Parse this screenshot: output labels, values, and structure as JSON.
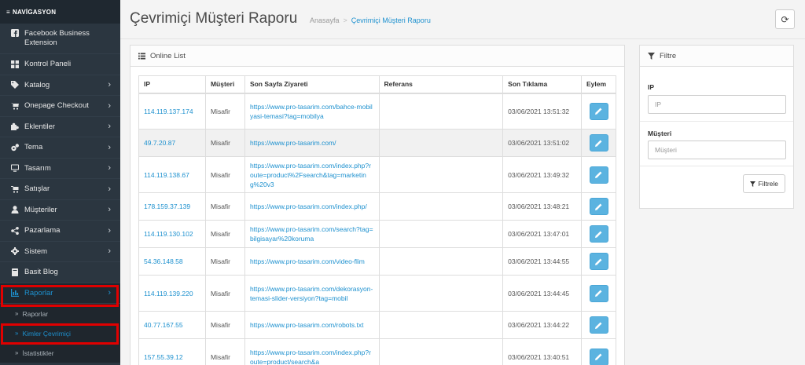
{
  "sidebar": {
    "header": "NAVİGASYON",
    "items": [
      {
        "label": "Facebook Business Extension",
        "icon": "facebook-icon",
        "chevron": false
      },
      {
        "label": "Kontrol Paneli",
        "icon": "dashboard-icon",
        "chevron": false
      },
      {
        "label": "Katalog",
        "icon": "tag-icon",
        "chevron": true
      },
      {
        "label": "Onepage Checkout",
        "icon": "cart-icon",
        "chevron": true
      },
      {
        "label": "Eklentiler",
        "icon": "puzzle-icon",
        "chevron": true
      },
      {
        "label": "Tema",
        "icon": "cogs-icon",
        "chevron": true
      },
      {
        "label": "Tasarım",
        "icon": "desktop-icon",
        "chevron": true
      },
      {
        "label": "Satışlar",
        "icon": "shopping-cart-icon",
        "chevron": true
      },
      {
        "label": "Müşteriler",
        "icon": "user-icon",
        "chevron": true
      },
      {
        "label": "Pazarlama",
        "icon": "share-icon",
        "chevron": true
      },
      {
        "label": "Sistem",
        "icon": "gear-icon",
        "chevron": true
      },
      {
        "label": "Basit Blog",
        "icon": "book-icon",
        "chevron": false
      },
      {
        "label": "Raporlar",
        "icon": "bar-chart-icon",
        "chevron": true
      }
    ],
    "subitems": [
      "Raporlar",
      "Kimler Çevrimiçi",
      "İstatistikler"
    ]
  },
  "header": {
    "title": "Çevrimiçi Müşteri Raporu",
    "breadcrumb_home": "Anasayfa",
    "breadcrumb_sep": ">",
    "breadcrumb_current": "Çevrimiçi Müşteri Raporu"
  },
  "list": {
    "heading": "Online List",
    "columns": [
      "IP",
      "Müşteri",
      "Son Sayfa Ziyareti",
      "Referans",
      "Son Tıklama",
      "Eylem"
    ],
    "rows": [
      {
        "ip": "114.119.137.174",
        "customer": "Misafir",
        "url": "https://www.pro-tasarim.com/bahce-mobilyasi-temasi?tag=mobilya",
        "ref": "",
        "date": "03/06/2021 13:51:32"
      },
      {
        "ip": "49.7.20.87",
        "customer": "Misafir",
        "url": "https://www.pro-tasarim.com/",
        "ref": "",
        "date": "03/06/2021 13:51:02"
      },
      {
        "ip": "114.119.138.67",
        "customer": "Misafir",
        "url": "https://www.pro-tasarim.com/index.php?route=product%2Fsearch&tag=marketing%20v3",
        "ref": "",
        "date": "03/06/2021 13:49:32"
      },
      {
        "ip": "178.159.37.139",
        "customer": "Misafir",
        "url": "https://www.pro-tasarim.com/index.php/",
        "ref": "",
        "date": "03/06/2021 13:48:21"
      },
      {
        "ip": "114.119.130.102",
        "customer": "Misafir",
        "url": "https://www.pro-tasarim.com/search?tag=bilgisayar%20koruma",
        "ref": "",
        "date": "03/06/2021 13:47:01"
      },
      {
        "ip": "54.36.148.58",
        "customer": "Misafir",
        "url": "https://www.pro-tasarim.com/video-flim",
        "ref": "",
        "date": "03/06/2021 13:44:55"
      },
      {
        "ip": "114.119.139.220",
        "customer": "Misafir",
        "url": "https://www.pro-tasarim.com/dekorasyon-temasi-slider-versiyon?tag=mobil",
        "ref": "",
        "date": "03/06/2021 13:44:45"
      },
      {
        "ip": "40.77.167.55",
        "customer": "Misafir",
        "url": "https://www.pro-tasarim.com/robots.txt",
        "ref": "",
        "date": "03/06/2021 13:44:22"
      },
      {
        "ip": "157.55.39.12",
        "customer": "Misafir",
        "url": "https://www.pro-tasarim.com/index.php?route=product/search&a",
        "ref": "",
        "date": "03/06/2021 13:40:51"
      }
    ]
  },
  "filter": {
    "heading": "Filtre",
    "ip_label": "IP",
    "ip_placeholder": "IP",
    "customer_label": "Müşteri",
    "customer_placeholder": "Müşteri",
    "button": "Filtrele"
  },
  "colors": {
    "accent": "#1e91cf",
    "sidebar": "#2b3640",
    "highlight": "#e00000"
  }
}
